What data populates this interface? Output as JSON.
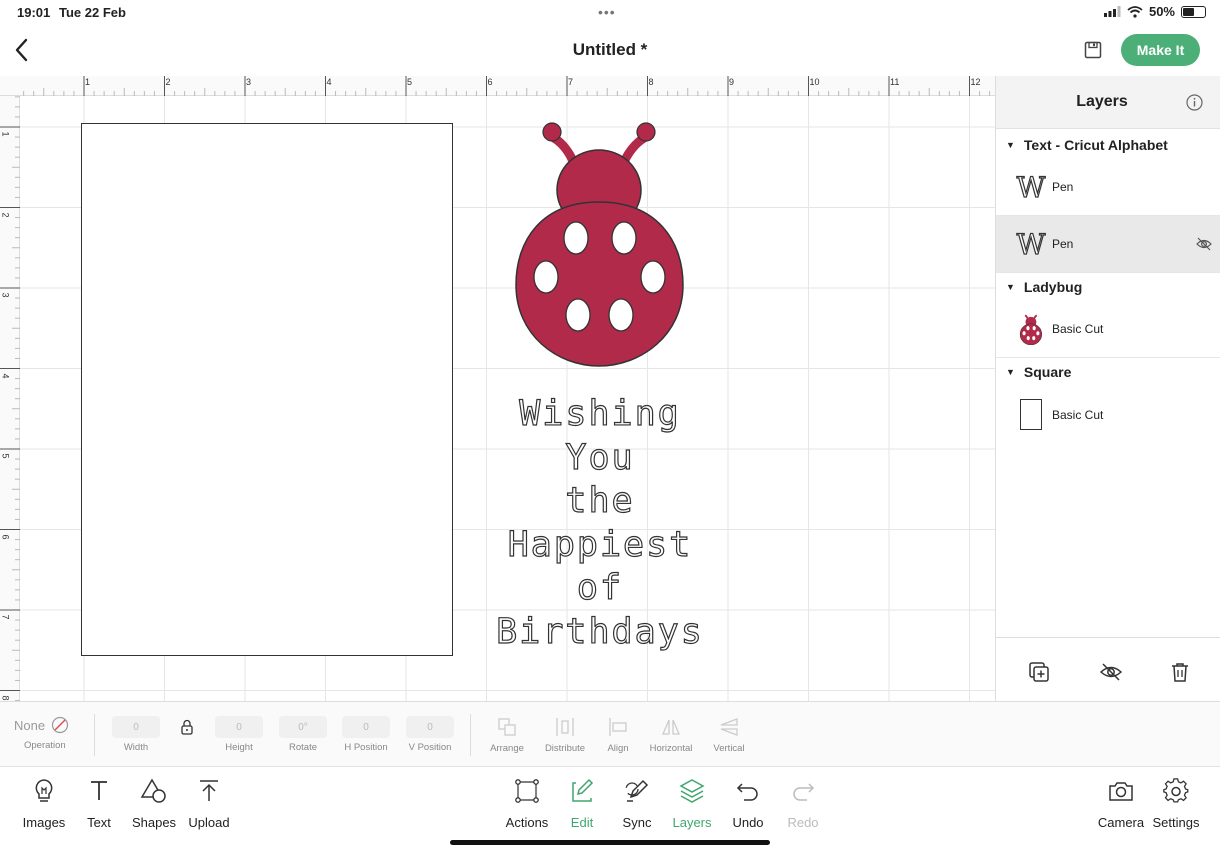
{
  "status_bar": {
    "time": "19:01",
    "date": "Tue 22 Feb",
    "battery": "50%",
    "battery_level": 0.5
  },
  "header": {
    "title": "Untitled *",
    "make_it_label": "Make It"
  },
  "rulers": {
    "top": [
      "1",
      "2",
      "3",
      "4",
      "5",
      "6",
      "7",
      "8",
      "9",
      "10",
      "11",
      "12"
    ],
    "left": [
      "1",
      "2",
      "3",
      "4",
      "5",
      "6",
      "7",
      "8"
    ]
  },
  "canvas": {
    "greeting_lines": [
      "Wishing",
      "You",
      "the",
      "Happiest",
      "of",
      "Birthdays"
    ],
    "ladybug_color": "#b12a4a"
  },
  "layers_panel": {
    "title": "Layers",
    "groups": [
      {
        "name": "Text - Cricut Alphabet",
        "items": [
          {
            "label": "Pen",
            "hidden": false
          },
          {
            "label": "Pen",
            "hidden": true,
            "selected": true
          }
        ]
      },
      {
        "name": "Ladybug",
        "items": [
          {
            "label": "Basic Cut"
          }
        ]
      },
      {
        "name": "Square",
        "items": [
          {
            "label": "Basic Cut"
          }
        ]
      }
    ]
  },
  "edit_toolbar": {
    "operation_value": "None",
    "operation_label": "Operation",
    "width_value": "0",
    "width_label": "Width",
    "height_value": "0",
    "height_label": "Height",
    "rotate_value": "0°",
    "rotate_label": "Rotate",
    "hpos_value": "0",
    "hpos_label": "H Position",
    "vpos_value": "0",
    "vpos_label": "V Position",
    "arrange_label": "Arrange",
    "distribute_label": "Distribute",
    "align_label": "Align",
    "horizontal_label": "Horizontal",
    "vertical_label": "Vertical"
  },
  "bottom_nav": {
    "images": "Images",
    "text": "Text",
    "shapes": "Shapes",
    "upload": "Upload",
    "actions": "Actions",
    "edit": "Edit",
    "sync": "Sync",
    "layers": "Layers",
    "undo": "Undo",
    "redo": "Redo",
    "camera": "Camera",
    "settings": "Settings"
  },
  "colors": {
    "accent": "#4caf78",
    "active_nav": "#3fa56d",
    "ladybug": "#b12a4a"
  }
}
